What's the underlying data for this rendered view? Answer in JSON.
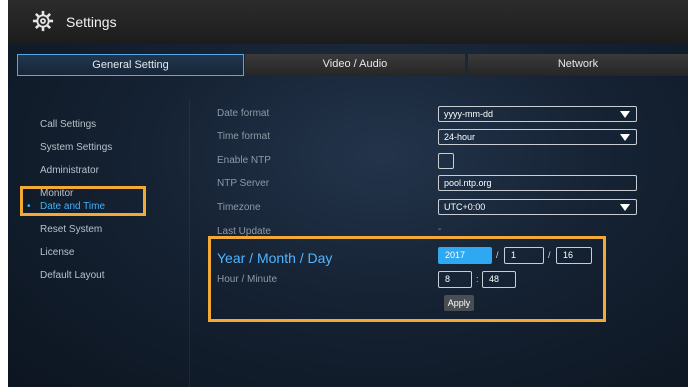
{
  "window": {
    "title": "Settings"
  },
  "tabs": [
    {
      "label": "General Setting"
    },
    {
      "label": "Video / Audio"
    },
    {
      "label": "Network"
    }
  ],
  "sidebar": {
    "items": [
      {
        "label": "Call Settings"
      },
      {
        "label": "System Settings"
      },
      {
        "label": "Administrator"
      },
      {
        "label": "Monitor"
      },
      {
        "label": "Date and Time",
        "active": true
      },
      {
        "label": "Reset System"
      },
      {
        "label": "License"
      },
      {
        "label": "Default Layout"
      }
    ],
    "active_marker": "•"
  },
  "main": {
    "date_format": {
      "label": "Date format",
      "value": "yyyy-mm-dd"
    },
    "time_format": {
      "label": "Time format",
      "value": "24-hour"
    },
    "enable_ntp": {
      "label": "Enable NTP",
      "checked": false
    },
    "ntp_server": {
      "label": "NTP Server",
      "value": "pool.ntp.org"
    },
    "timezone": {
      "label": "Timezone",
      "value": "UTC+0:00"
    },
    "last_update": {
      "label": "Last Update",
      "value": "-"
    },
    "date_entry": {
      "label": "Year / Month / Day",
      "year": "2017",
      "month": "1",
      "day": "16",
      "separator": "/"
    },
    "time_entry": {
      "label": "Hour / Minute",
      "hour": "8",
      "minute": "48",
      "separator": ":"
    },
    "apply_label": "Apply"
  },
  "colors": {
    "highlight": "#f3a935",
    "accent": "#3fb1ff"
  },
  "icons": {
    "title": "gear-icon",
    "dropdown": "chevron-down-icon"
  }
}
